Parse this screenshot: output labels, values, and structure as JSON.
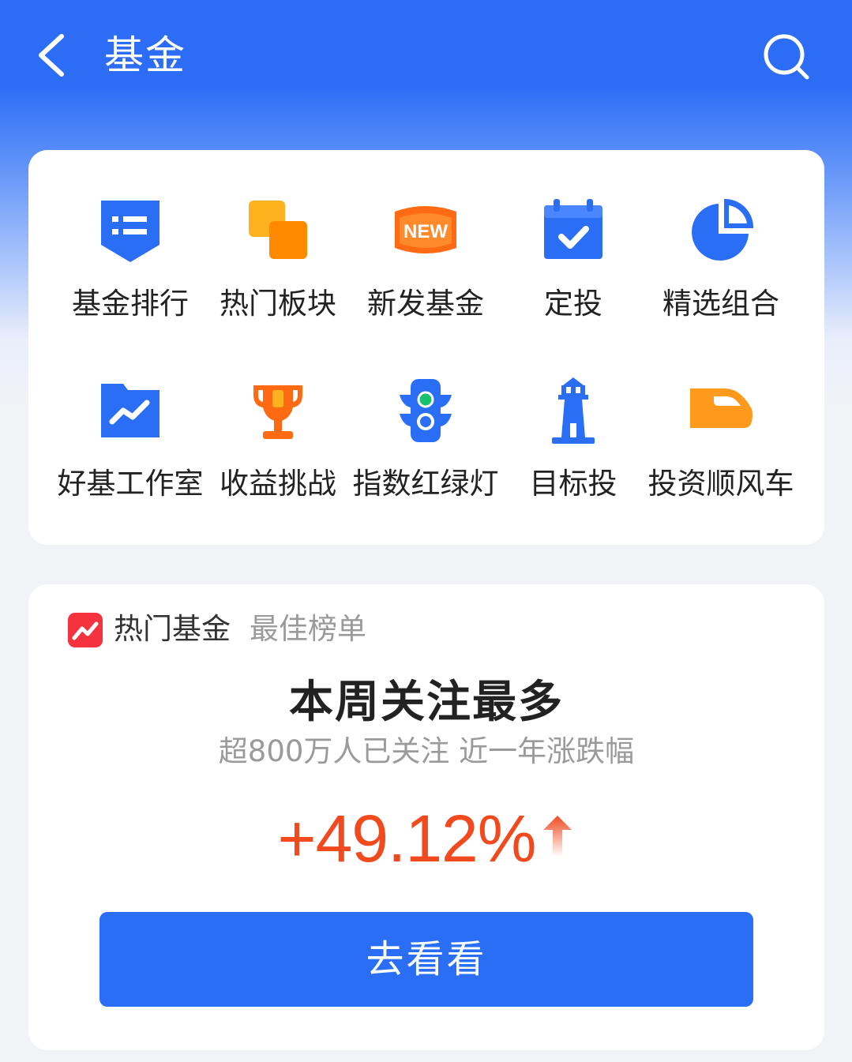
{
  "header": {
    "title": "基金",
    "back_icon": "chevron-left-icon",
    "search_icon": "search-icon"
  },
  "menu": {
    "items": [
      {
        "label": "基金排行",
        "icon": "ranking-list-icon"
      },
      {
        "label": "热门板块",
        "icon": "stacked-squares-icon"
      },
      {
        "label": "新发基金",
        "icon": "new-badge-icon"
      },
      {
        "label": "定投",
        "icon": "calendar-check-icon"
      },
      {
        "label": "精选组合",
        "icon": "pie-chart-icon"
      },
      {
        "label": "好基工作室",
        "icon": "trend-folder-icon"
      },
      {
        "label": "收益挑战",
        "icon": "trophy-icon"
      },
      {
        "label": "指数红绿灯",
        "icon": "traffic-light-icon"
      },
      {
        "label": "目标投",
        "icon": "lighthouse-icon"
      },
      {
        "label": "投资顺风车",
        "icon": "bullet-train-icon"
      }
    ]
  },
  "hot_fund": {
    "title": "热门基金",
    "subtitle": "最佳榜单",
    "headline": "本周关注最多",
    "description": "超800万人已关注 近一年涨跌幅",
    "value": "+49.12%",
    "button_label": "去看看"
  },
  "colors": {
    "primary_blue": "#2a6ef6",
    "orange": "#ff8a00",
    "red_up": "#f04a1e",
    "text_dark": "#222222",
    "text_grey": "#9a9a9a"
  }
}
